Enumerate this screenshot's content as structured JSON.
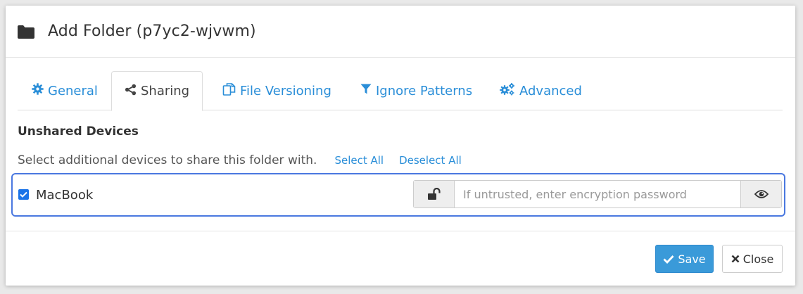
{
  "dialog": {
    "title": "Add Folder (p7yc2-wjvwm)",
    "icon": "folder-icon"
  },
  "tabs": [
    {
      "label": "General",
      "icon": "gear-icon",
      "active": false
    },
    {
      "label": "Sharing",
      "icon": "share-icon",
      "active": true
    },
    {
      "label": "File Versioning",
      "icon": "files-icon",
      "active": false
    },
    {
      "label": "Ignore Patterns",
      "icon": "filter-icon",
      "active": false
    },
    {
      "label": "Advanced",
      "icon": "gears-icon",
      "active": false
    }
  ],
  "sharing": {
    "section_title": "Unshared Devices",
    "helper_text": "Select additional devices to share this folder with.",
    "select_all": "Select All",
    "deselect_all": "Deselect All",
    "devices": [
      {
        "name": "MacBook",
        "checked": true,
        "password_placeholder": "If untrusted, enter encryption password",
        "password_value": ""
      }
    ]
  },
  "footer": {
    "save_label": "Save",
    "close_label": "Close"
  },
  "colors": {
    "link": "#2a8ed8",
    "primary_button": "#3a9ad9",
    "focus_border": "#4a78e0"
  }
}
